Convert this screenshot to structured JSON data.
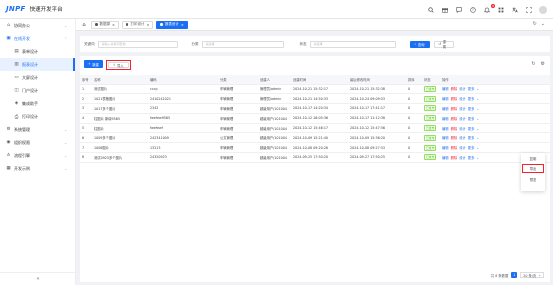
{
  "header": {
    "logo": "JNPF",
    "title": "快速开发平台",
    "notification_count": "9"
  },
  "sidebar": {
    "items": [
      {
        "label": "协同办公",
        "icon": "home-icon",
        "level": 0
      },
      {
        "label": "在线开发",
        "icon": "code-icon",
        "level": 0,
        "open": true
      },
      {
        "label": "表单设计",
        "icon": "form-icon",
        "level": 1
      },
      {
        "label": "报表设计",
        "icon": "report-icon",
        "level": 1,
        "active": true
      },
      {
        "label": "大屏设计",
        "icon": "screen-icon",
        "level": 1
      },
      {
        "label": "门户设计",
        "icon": "portal-icon",
        "level": 1
      },
      {
        "label": "集成助手",
        "icon": "plug-icon",
        "level": 1
      },
      {
        "label": "打印设计",
        "icon": "print-icon",
        "level": 1
      },
      {
        "label": "系统管理",
        "icon": "gear-icon",
        "level": 0
      },
      {
        "label": "组织权限",
        "icon": "org-icon",
        "level": 0
      },
      {
        "label": "流程引擎",
        "icon": "flow-icon",
        "level": 0
      },
      {
        "label": "开发示例",
        "icon": "grid-icon",
        "level": 0
      }
    ],
    "collapse": "«"
  },
  "tabs": [
    {
      "label": "数据源",
      "active": false
    },
    {
      "label": "打印设计",
      "active": false
    },
    {
      "label": "报表设计",
      "active": true
    }
  ],
  "search": {
    "keyword_label": "关键词",
    "keyword_placeholder": "请输入关键词查询",
    "category_label": "分类",
    "category_placeholder": "请选择",
    "status_label": "状态",
    "status_placeholder": "请选择",
    "query_button": "查询",
    "reset_button": "重置"
  },
  "toolbar": {
    "add_label": "新建",
    "import_label": "导入"
  },
  "table": {
    "columns": [
      "序号",
      "名称",
      "编码",
      "分类",
      "创建人",
      "创建时间",
      "最后修改时间",
      "排序",
      "状态",
      "操作"
    ],
    "rows": [
      [
        "1",
        "测试图片",
        "cccp",
        "车辆管理",
        "管理员/admin",
        "2024-10-21 15:32:17",
        "2024-10-21 15:32:38",
        "0",
        "已发布"
      ],
      [
        "2",
        "1021表格图片",
        "2410241021",
        "车辆管理",
        "管理员/admin",
        "2024-10-21 14:50:33",
        "2024-10-24 09:09:53",
        "0",
        "已发布"
      ],
      [
        "3",
        "1017多个图片",
        "2342",
        "车辆管理",
        "超级用户/101004",
        "2024-10-17 14:20:34",
        "2024-10-17 17:41:17",
        "0",
        "已发布"
      ],
      [
        "4",
        "柱图片 新增9565",
        "fwefew9565",
        "车辆管理",
        "超级用户/101004",
        "2024-10-12 16:05:36",
        "2024-10-17 11:12:38",
        "0",
        "已发布"
      ],
      [
        "5",
        "柱图片",
        "fwefewf",
        "车辆管理",
        "超级用户/101004",
        "2024-10-12 15:46:17",
        "2024-10-12 15:47:56",
        "0",
        "已发布"
      ],
      [
        "6",
        "1009多个图片",
        "242341009",
        "公文管理",
        "超级用户/101004",
        "2024-10-09 15:21:40",
        "2024-10-09 15:36:20",
        "0",
        "已发布"
      ],
      [
        "7",
        "1008图片",
        "13213",
        "车辆管理",
        "超级用户/101004",
        "2024-10-08 09:20:26",
        "2024-10-08 09:27:53",
        "0",
        "已发布"
      ],
      [
        "8",
        "测试0925多个图片",
        "24320923",
        "车辆管理",
        "超级用户/101004",
        "2024-09-25 17:50:20",
        "2024-09-27 17:50:25",
        "0",
        "已发布"
      ]
    ],
    "actions": {
      "edit": "编辑",
      "delete": "删除",
      "design": "设计",
      "more": "更多"
    }
  },
  "dropdown": {
    "items": [
      "复制",
      "导出",
      "预览"
    ]
  },
  "pagination": {
    "total": "共 8 条数据",
    "current_page": "1",
    "page_size": "20 条/页"
  },
  "colors": {
    "primary": "#1a6ff5",
    "danger": "#f5222d",
    "success": "#52c41a"
  }
}
